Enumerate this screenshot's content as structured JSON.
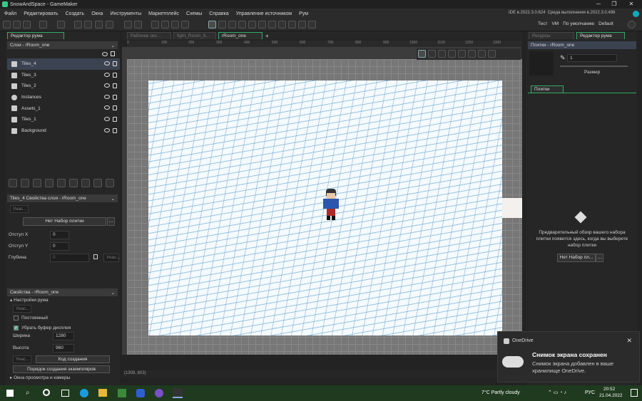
{
  "window": {
    "title": "SnowAndSpace - GameMaker",
    "min": "─",
    "max": "❐",
    "close": "✕"
  },
  "menu": [
    "Файл",
    "Редактировать",
    "Создать",
    "Окна",
    "Инструменты",
    "Маркетплейс",
    "Схемы",
    "Справка",
    "Управление источником",
    "Рум"
  ],
  "menu_right": {
    "ide": "IDE в.2022.3.0.624",
    "runtime": "Среда выполнения в.2022.3.0.496",
    "test": "Тест",
    "vm": "VM",
    "default_label": "По умолчанию",
    "default": "Default"
  },
  "left": {
    "tab": "Редактор рума",
    "layers_header": "Слои - rRoom_one",
    "layers": [
      "Tiles_4",
      "Tiles_3",
      "Tiles_2",
      "Instances",
      "Assets_1",
      "Tiles_1",
      "Background"
    ],
    "props_header": "Tiles_4 Свойства слоя - rRoom_one",
    "inherit": "Унас...",
    "tileset_btn": "Нет Набор плитки",
    "offset_x_label": "Отступ X",
    "offset_x": "0",
    "offset_y_label": "Отступ Y",
    "offset_y": "0",
    "depth_label": "Глубина",
    "depth": "0",
    "depth_inherit": "Унас...",
    "room_header": "Свойства - rRoom_one",
    "room_settings": "Настройки рума",
    "room_inherit": "Унас...",
    "persistent": "Постоянный",
    "clear_buffer": "Убрать буфер дисплея",
    "width_label": "Ширина",
    "width": "1280",
    "height_label": "Высота",
    "height": "960",
    "creation_code": "Код создания",
    "instance_order": "Порядок создания экземпляров",
    "views": "Окна просмотра и камеры"
  },
  "tabs": [
    "Рабочее окс...",
    "fight_Room_b...",
    "rRoom_one"
  ],
  "ruler_marks": [
    "0",
    "100",
    "200",
    "300",
    "400",
    "500",
    "600",
    "700",
    "800",
    "900",
    "1000",
    "1100",
    "1200",
    "1300"
  ],
  "coords": "(1308, 603)",
  "right": {
    "tabs": [
      "Ресурсы",
      "Редактор рума"
    ],
    "plates_header": "Плитки - rRoom_one",
    "brush_value": "1",
    "size_label": "Размер",
    "plates_tab": "Плитки",
    "preview_text": "Предварительный обзор вашего набора плитки появится здесь, когда вы выберете набор плитки",
    "no_tileset_btn": "Нет Набор пл..."
  },
  "toast": {
    "app": "OneDrive",
    "title": "Снимок экрана сохранен",
    "body": "Снимок экрана добавлен в ваше хранилище OneDrive."
  },
  "taskbar": {
    "weather": "7°C Partly cloudy",
    "lang": "РУС",
    "time": "20:52",
    "date": "21.04.2022"
  }
}
